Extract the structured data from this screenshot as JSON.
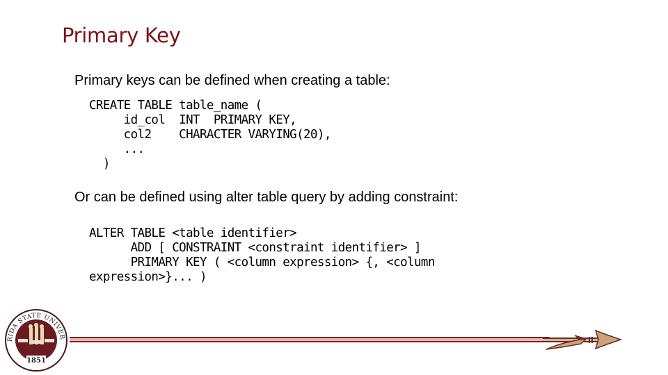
{
  "slide": {
    "title": "Primary Key",
    "intro_text": "Primary keys can be defined when creating a table:",
    "create_code": "CREATE TABLE table_name (\n     id_col  INT  PRIMARY KEY,\n     col2    CHARACTER VARYING(20),\n     ...\n  )",
    "alter_text": "Or can be defined using alter table query by adding constraint:",
    "alter_code": "ALTER TABLE <table identifier>\n      ADD [ CONSTRAINT <constraint identifier> ]\n      PRIMARY KEY ( <column expression> {, <column\nexpression>}... )"
  },
  "footer": {
    "seal_top_text": "FLORIDA STATE UNIVERSITY",
    "seal_year": "1851",
    "colors": {
      "garnet": "#782f40",
      "gold": "#ceb888"
    }
  }
}
